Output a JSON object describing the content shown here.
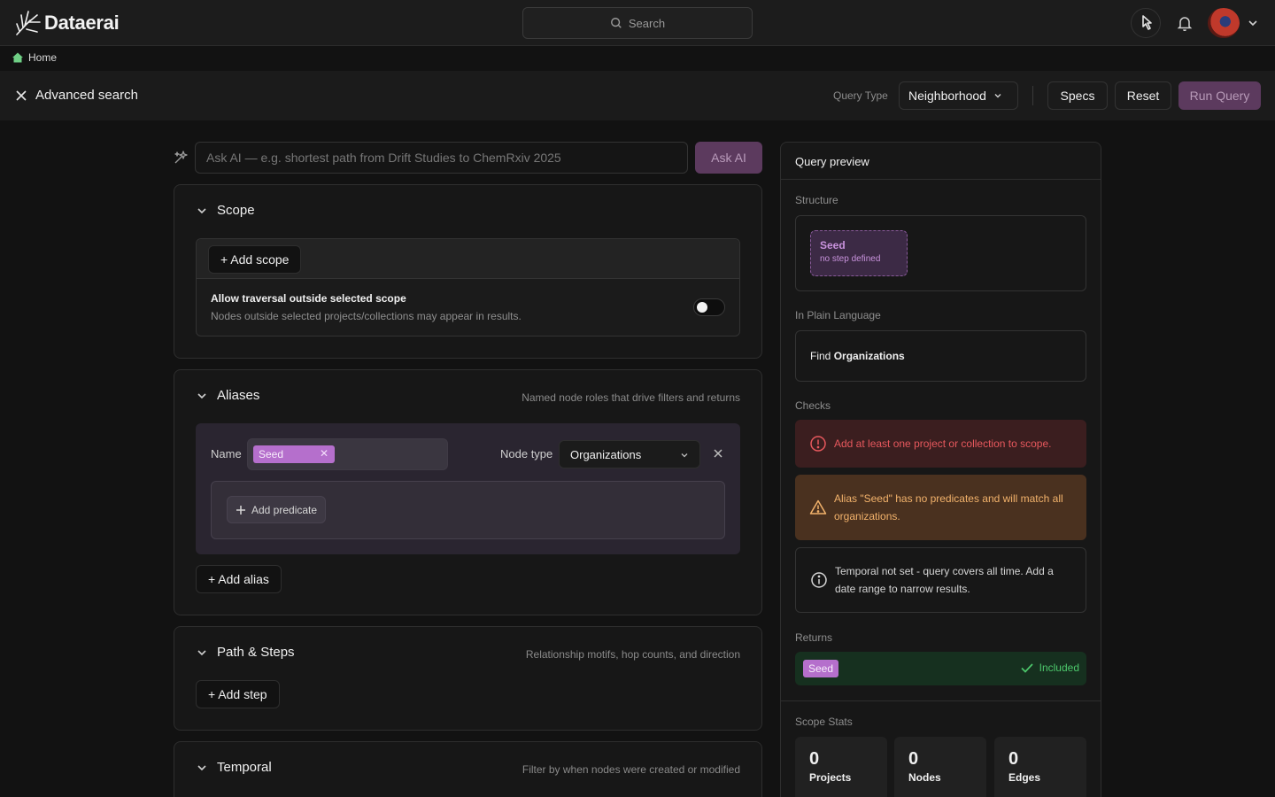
{
  "brand": {
    "name": "Dataerai"
  },
  "topbar": {
    "search_label": "Search"
  },
  "breadcrumb": {
    "home": "Home"
  },
  "header": {
    "title": "Advanced search",
    "query_type_label": "Query Type",
    "query_type_value": "Neighborhood",
    "specs": "Specs",
    "reset": "Reset",
    "run": "Run Query"
  },
  "ask_ai": {
    "placeholder": "Ask AI — e.g. shortest path from Drift Studies to ChemRxiv 2025",
    "button": "Ask AI"
  },
  "sections": {
    "scope": {
      "title": "Scope",
      "add_btn": "+ Add scope",
      "traversal_title": "Allow traversal outside selected scope",
      "traversal_desc": "Nodes outside selected projects/collections may appear in results.",
      "traversal_enabled": false
    },
    "aliases": {
      "title": "Aliases",
      "subtitle": "Named node roles that drive filters and returns",
      "name_label": "Name",
      "name_value": "Seed",
      "node_type_label": "Node type",
      "node_type_value": "Organizations",
      "add_predicate": "Add predicate",
      "add_btn": "+ Add alias"
    },
    "path": {
      "title": "Path & Steps",
      "subtitle": "Relationship motifs, hop counts, and direction",
      "add_btn": "+ Add step"
    },
    "temporal": {
      "title": "Temporal",
      "subtitle": "Filter by when nodes were created or modified"
    }
  },
  "preview": {
    "title": "Query preview",
    "structure_label": "Structure",
    "seed_title": "Seed",
    "seed_sub": "no step defined",
    "plain_label": "In Plain Language",
    "plain_prefix": "Find",
    "plain_bold": "Organizations",
    "checks_label": "Checks",
    "checks": {
      "error": "Add at least one project or collection to scope.",
      "warning": "Alias \"Seed\" has no predicates and will match all organizations.",
      "info": "Temporal not set - query covers all time. Add a date range to narrow results."
    },
    "returns_label": "Returns",
    "returns_tag": "Seed",
    "returns_status": "Included",
    "stats_label": "Scope Stats",
    "stats": {
      "projects": {
        "value": "0",
        "label": "Projects"
      },
      "nodes": {
        "value": "0",
        "label": "Nodes"
      },
      "edges": {
        "value": "0",
        "label": "Edges"
      }
    }
  },
  "colors": {
    "accent": "#5c3a5e",
    "tag": "#b56fcc",
    "error": "#e7585d",
    "warning": "#f2b26b",
    "success": "#4cc76b"
  }
}
